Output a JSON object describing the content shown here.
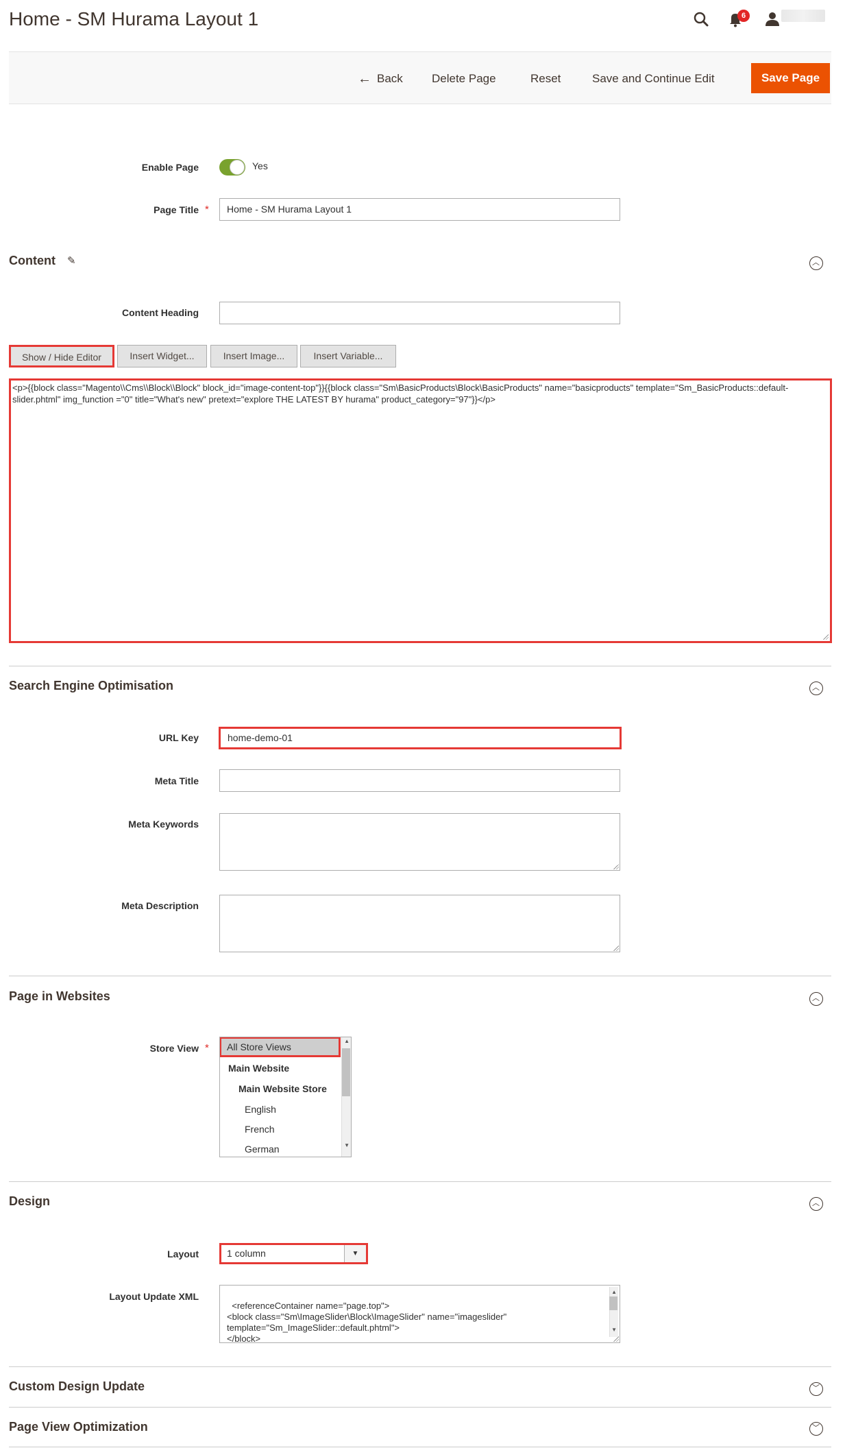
{
  "header": {
    "title": "Home - SM Hurama Layout 1",
    "notification_count": "6"
  },
  "actions": {
    "back": "Back",
    "delete": "Delete Page",
    "reset": "Reset",
    "save_continue": "Save and Continue Edit",
    "save": "Save Page"
  },
  "general": {
    "enable_label": "Enable Page",
    "enable_value": "Yes",
    "title_label": "Page Title",
    "title_value": "Home - SM Hurama Layout 1"
  },
  "content": {
    "section_title": "Content",
    "heading_label": "Content Heading",
    "heading_value": "",
    "buttons": {
      "show_hide": "Show / Hide Editor",
      "insert_widget": "Insert Widget...",
      "insert_image": "Insert Image...",
      "insert_variable": "Insert Variable..."
    },
    "editor_text": "<p>{{block class=\"Magento\\\\Cms\\\\Block\\\\Block\" block_id=\"image-content-top\"}}{{block class=\"Sm\\BasicProducts\\Block\\BasicProducts\" name=\"basicproducts\" template=\"Sm_BasicProducts::default-slider.phtml\" img_function =\"0\" title=\"What's new\" pretext=\"explore THE LATEST BY hurama\" product_category=\"97\"}}</p>"
  },
  "seo": {
    "section_title": "Search Engine Optimisation",
    "url_key_label": "URL Key",
    "url_key_value": "home-demo-01",
    "meta_title_label": "Meta Title",
    "meta_title_value": "",
    "meta_keywords_label": "Meta Keywords",
    "meta_description_label": "Meta Description"
  },
  "websites": {
    "section_title": "Page in Websites",
    "store_view_label": "Store View",
    "options": [
      "All Store Views",
      "Main Website",
      "Main Website Store",
      "English",
      "French",
      "German"
    ]
  },
  "design": {
    "section_title": "Design",
    "layout_label": "Layout",
    "layout_value": "1 column",
    "xml_label": "Layout Update XML",
    "xml_value": "<referenceContainer name=\"page.top\">\n<block class=\"Sm\\ImageSlider\\Block\\ImageSlider\" name=\"imageslider\"\ntemplate=\"Sm_ImageSlider::default.phtml\">\n</block>\n      <block class=\"Magento\\Cms\\Block\\Block\" name=\"freeship\">"
  },
  "custom_design": {
    "section_title": "Custom Design Update"
  },
  "page_view": {
    "section_title": "Page View Optimization"
  },
  "colors": {
    "accent": "#eb5202",
    "highlight": "#e53935",
    "toggle_on": "#79a22e"
  },
  "icons": {
    "search": "search-icon",
    "bell": "bell-icon",
    "user": "user-icon",
    "pencil": "pencil-icon",
    "collapse": "chevron-circle-icon"
  }
}
